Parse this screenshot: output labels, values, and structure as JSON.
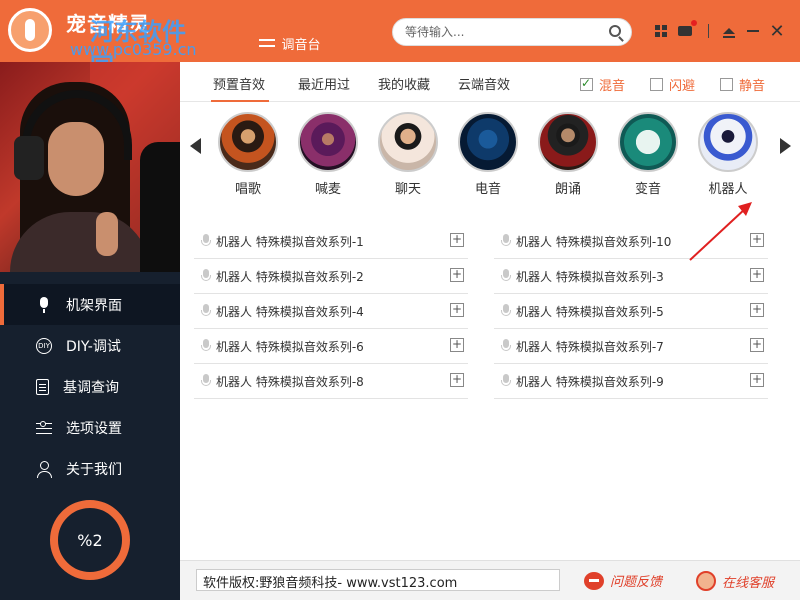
{
  "app": {
    "title": "宠音精灵",
    "watermark_name": "河东软件园",
    "watermark_site": "www.pc0359.cn",
    "watermark_sub": "pc0359"
  },
  "topbar": {
    "console_tab": "调音台",
    "search_placeholder": "等待输入...",
    "icons": [
      "grid-icon",
      "skin-icon",
      "eject-icon",
      "minimize-icon",
      "close-icon"
    ]
  },
  "subtabs": {
    "tabs": [
      "预置音效",
      "最近用过",
      "我的收藏",
      "云端音效"
    ],
    "active": 0,
    "options": [
      {
        "label": "混音",
        "checked": true
      },
      {
        "label": "闪避",
        "checked": false
      },
      {
        "label": "静音",
        "checked": false
      }
    ]
  },
  "effects": [
    {
      "label": "唱歌"
    },
    {
      "label": "喊麦"
    },
    {
      "label": "聊天"
    },
    {
      "label": "电音"
    },
    {
      "label": "朗诵"
    },
    {
      "label": "变音"
    },
    {
      "label": "机器人"
    }
  ],
  "list": {
    "left": [
      "机器人 特殊模拟音效系列-1",
      "机器人 特殊模拟音效系列-2",
      "机器人 特殊模拟音效系列-4",
      "机器人 特殊模拟音效系列-6",
      "机器人 特殊模拟音效系列-8"
    ],
    "right": [
      "机器人 特殊模拟音效系列-10",
      "机器人 特殊模拟音效系列-3",
      "机器人 特殊模拟音效系列-5",
      "机器人 特殊模拟音效系列-7",
      "机器人 特殊模拟音效系列-9"
    ]
  },
  "nav": [
    {
      "label": "机架界面",
      "icon": "mic-icon",
      "active": true
    },
    {
      "label": "DIY-调试",
      "icon": "diy-icon",
      "active": false
    },
    {
      "label": "基调查询",
      "icon": "document-icon",
      "active": false
    },
    {
      "label": "选项设置",
      "icon": "settings-icon",
      "active": false
    },
    {
      "label": "关于我们",
      "icon": "user-icon",
      "active": false
    }
  ],
  "status": {
    "ring_text": "%2"
  },
  "footer": {
    "copyright": "软件版权:野狼音频科技- www.vst123.com",
    "feedback": "问题反馈",
    "support": "在线客服"
  },
  "colors": {
    "accent": "#ef6b3a",
    "sidebar": "#16202e",
    "footer_link": "#e0402a"
  }
}
